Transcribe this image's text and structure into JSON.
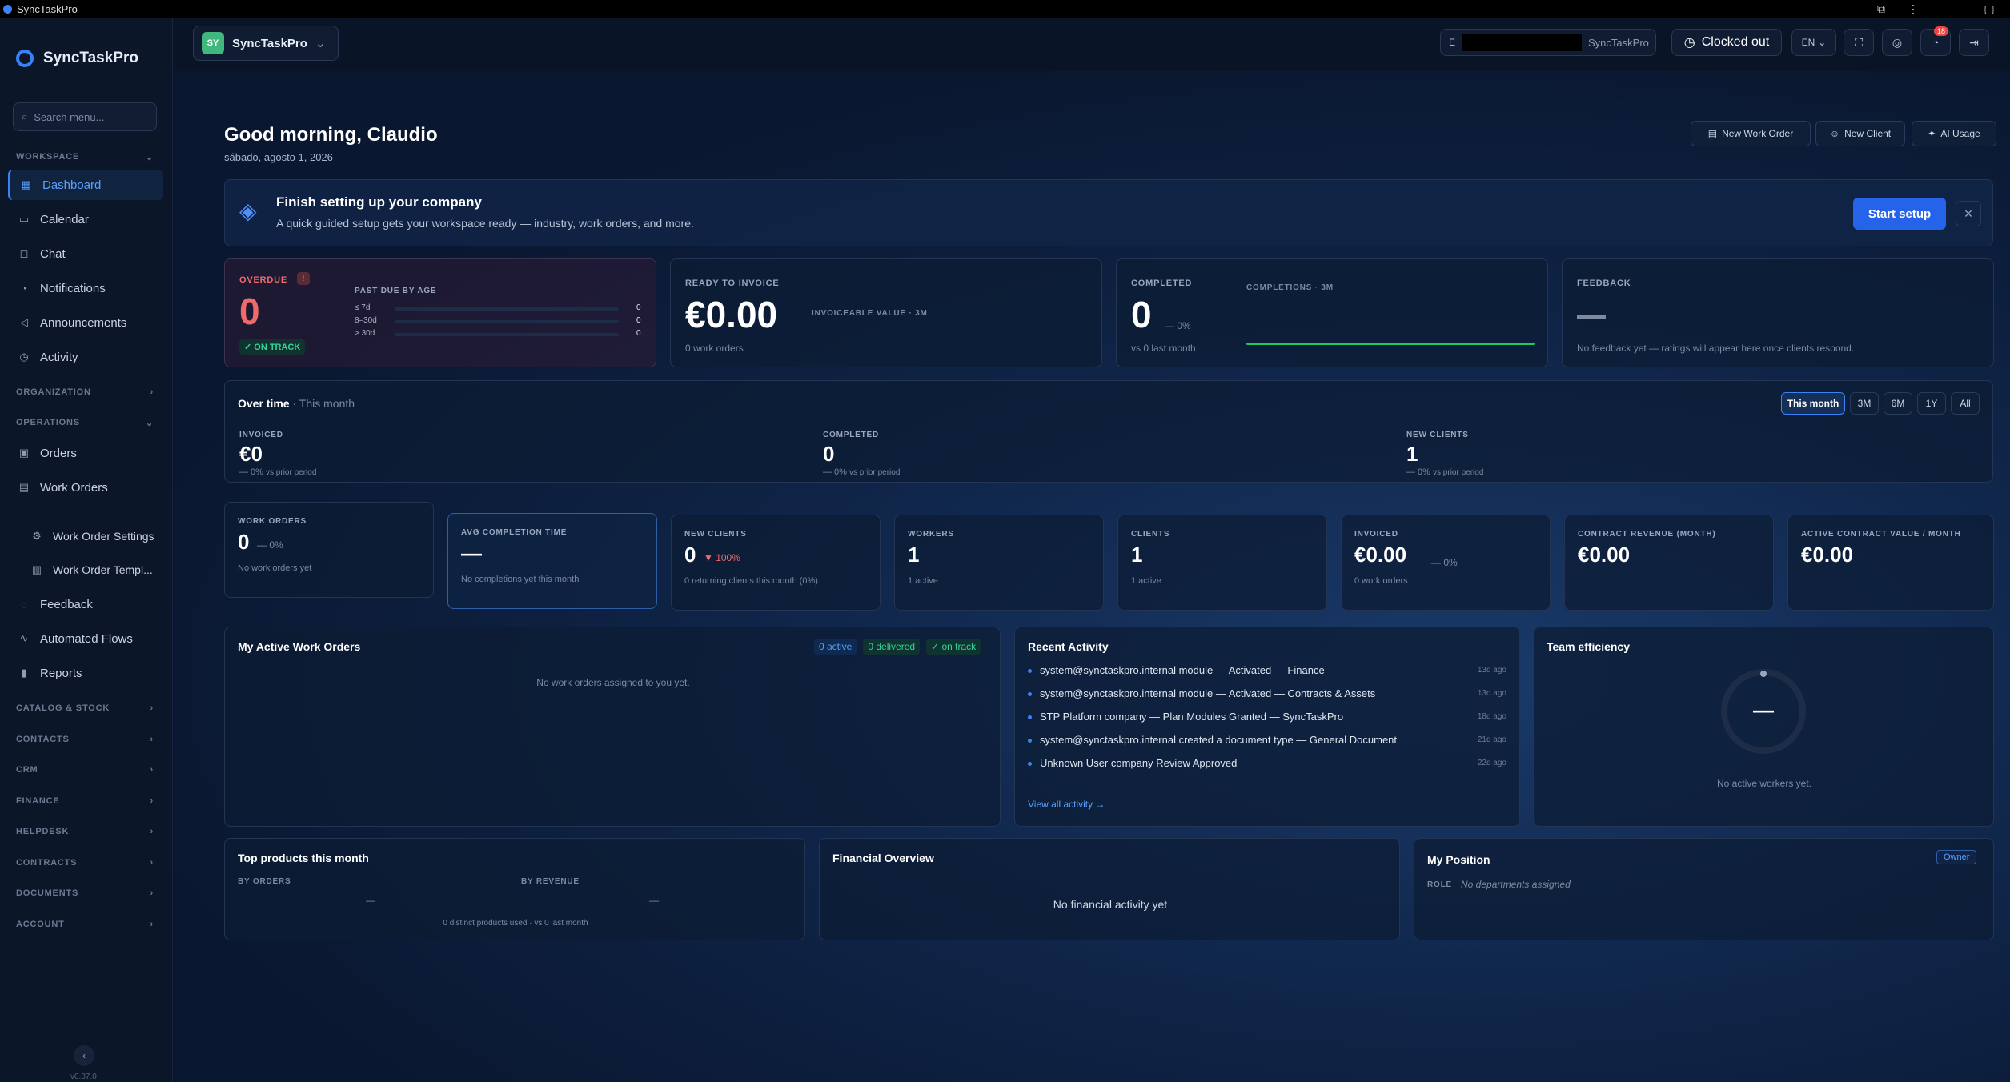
{
  "window": {
    "title": "SyncTaskPro"
  },
  "brand": "SyncTaskPro",
  "sidebar": {
    "search_placeholder": "Search menu...",
    "workspace_label": "WORKSPACE",
    "organization_label": "ORGANIZATION",
    "operations_label": "OPERATIONS",
    "items": {
      "dashboard": "Dashboard",
      "calendar": "Calendar",
      "chat": "Chat",
      "notifications": "Notifications",
      "announcements": "Announcements",
      "activity": "Activity",
      "orders": "Orders",
      "work_orders": "Work Orders",
      "work_order_settings": "Work Order Settings",
      "work_order_templates": "Work Order Templ...",
      "feedback": "Feedback",
      "automated_flows": "Automated Flows",
      "reports": "Reports"
    },
    "groups": {
      "catalog": "CATALOG & STOCK",
      "contacts": "CONTACTS",
      "crm": "CRM",
      "finance": "FINANCE",
      "helpdesk": "HELPDESK",
      "contracts": "CONTRACTS",
      "documents": "DOCUMENTS",
      "account": "ACCOUNT"
    },
    "version": "v0.87.0"
  },
  "topbar": {
    "workspace_initials": "SY",
    "workspace_name": "SyncTaskPro",
    "user_prefix": "E",
    "user_workspace": "SyncTaskPro",
    "clock_status": "Clocked out",
    "language": "EN",
    "notif_count": "18"
  },
  "greeting": {
    "title": "Good morning, Claudio",
    "date": "sábado, agosto 1, 2026"
  },
  "actions": {
    "new_work_order": "New Work Order",
    "new_client": "New Client",
    "ai_usage": "AI Usage"
  },
  "setup": {
    "title": "Finish setting up your company",
    "desc": "A quick guided setup gets your workspace ready — industry, work orders, and more.",
    "button": "Start setup"
  },
  "overdue": {
    "label": "OVERDUE",
    "alert": "!",
    "value": "0",
    "status": "✓ ON TRACK",
    "age_label": "PAST DUE BY AGE",
    "rows": [
      {
        "k": "≤ 7d",
        "v": "0"
      },
      {
        "k": "8–30d",
        "v": "0"
      },
      {
        "k": "> 30d",
        "v": "0"
      }
    ]
  },
  "ready": {
    "label": "READY TO INVOICE",
    "value": "€0.00",
    "sub": "INVOICEABLE VALUE · 3M",
    "count": "0 work orders"
  },
  "completed": {
    "label": "COMPLETED",
    "value": "0",
    "delta": "— 0%",
    "vs": "vs 0 last month",
    "chart_label": "COMPLETIONS · 3M"
  },
  "feedback": {
    "label": "FEEDBACK",
    "empty": "No feedback yet — ratings will appear here once clients respond."
  },
  "overtime": {
    "title": "Over time",
    "period": "· This month",
    "ranges": [
      "This month",
      "3M",
      "6M",
      "1Y",
      "All"
    ],
    "metrics": [
      {
        "label": "INVOICED",
        "value": "€0",
        "delta": "— 0%",
        "vs": "vs prior period"
      },
      {
        "label": "COMPLETED",
        "value": "0",
        "delta": "— 0%",
        "vs": "vs prior period"
      },
      {
        "label": "NEW CLIENTS",
        "value": "1",
        "delta": "— 0%",
        "vs": "vs prior period"
      }
    ]
  },
  "kpis": {
    "work_orders": {
      "label": "WORK ORDERS",
      "value": "0",
      "delta": "— 0%",
      "sub": "No work orders yet"
    },
    "avg": {
      "label": "AVG COMPLETION TIME",
      "value": "—",
      "sub": "No completions yet this month"
    },
    "new_clients": {
      "label": "NEW CLIENTS",
      "value": "0",
      "delta": "▼ 100%",
      "sub": "0 returning clients this month (0%)"
    },
    "workers": {
      "label": "WORKERS",
      "value": "1",
      "sub": "1 active"
    },
    "clients": {
      "label": "CLIENTS",
      "value": "1",
      "sub": "1 active"
    },
    "invoiced": {
      "label": "INVOICED",
      "value": "€0.00",
      "delta": "— 0%",
      "sub": "0 work orders"
    },
    "contract_rev": {
      "label": "CONTRACT REVENUE (MONTH)",
      "value": "€0.00"
    },
    "active_contract": {
      "label": "ACTIVE CONTRACT VALUE / MONTH",
      "value": "€0.00"
    }
  },
  "my_orders": {
    "title": "My Active Work Orders",
    "active": "0 active",
    "delivered": "0 delivered",
    "track": "✓ on track",
    "empty": "No work orders assigned to you yet."
  },
  "recent": {
    "title": "Recent Activity",
    "link": "View all activity →",
    "items": [
      {
        "text": "system@synctaskpro.internal module — Activated — Finance",
        "ago": "13d ago"
      },
      {
        "text": "system@synctaskpro.internal module — Activated — Contracts & Assets",
        "ago": "13d ago"
      },
      {
        "text": "STP Platform company — Plan Modules Granted — SyncTaskPro",
        "ago": "18d ago"
      },
      {
        "text": "system@synctaskpro.internal created a document type — General Document",
        "ago": "21d ago"
      },
      {
        "text": "Unknown User company Review Approved",
        "ago": "22d ago"
      }
    ]
  },
  "team": {
    "title": "Team efficiency",
    "value": "—",
    "empty": "No active workers yet."
  },
  "products": {
    "title": "Top products this month",
    "by_orders": "BY ORDERS",
    "by_revenue": "BY REVENUE",
    "orders_val": "—",
    "revenue_val": "—",
    "foot": "0 distinct products used · vs 0 last month"
  },
  "financial": {
    "title": "Financial Overview",
    "empty": "No financial activity yet"
  },
  "position": {
    "title": "My Position",
    "badge": "Owner",
    "role_label": "ROLE",
    "role_value": "No departments assigned"
  },
  "colors": {
    "accent": "#3b82f6",
    "success": "#22c55e",
    "danger": "#ef4444",
    "warning": "#f59e0b"
  }
}
